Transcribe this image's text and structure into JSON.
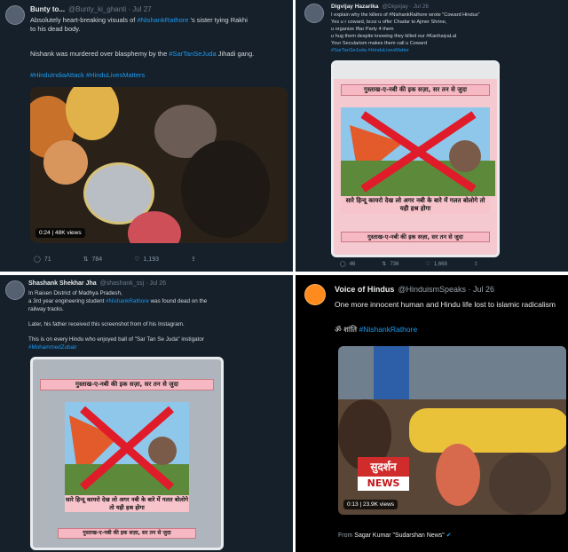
{
  "p1": {
    "name": "Bunty to...",
    "handle": "@Bunty_ki_ghanti · Jul 27",
    "line1_a": "Absolutely heart-breaking visuals of ",
    "line1_tag": "#NishankRathore",
    "line1_b": " 's sister tying Rakhi",
    "line2": "to his dead body.",
    "line3_a": "Nishank was murdered over blasphemy by the ",
    "line3_tag": "#SarTanSeJuda",
    "line3_b": " Jihadi gang.",
    "tags": "#HinduIndiaAttack #HinduLivesMatters",
    "video_time": "0:24",
    "video_views": "48K views",
    "replies": "71",
    "retweets": "784",
    "likes": "1,193"
  },
  "p2": {
    "name": "Digvijay Hazarika",
    "handle": "@Digvijay · Jul 26",
    "l1": "I explain why the killers of #NishankRathore wrote \"Coward Hindus\"",
    "l2": "Yes u r coward, bcoz u offer Chadar to Ajmer Shrine,",
    "l3": "u organize Iftar Party 4 them",
    "l4": "u hug them despite knowing they killed our #KanhaiyaLal",
    "l5": "Your Secularism makes them call u Coward",
    "l6": "#SarTanSeJuda #HinduLivesMatter",
    "poster_head": "गुस्ताख-ए-नबी की इक सज़ा, सर तन से जुदा",
    "poster_mid": "सारे हिन्दू कायरो देख लो अगर नबी के बारे में गलत बोलोगे तो यही हश्र होगा",
    "poster_foot": "गुस्ताख-ए-नबी की इक सज़ा, सर तन से जुदा",
    "replies": "46",
    "retweets": "736",
    "likes": "1,668"
  },
  "p3": {
    "name": "Shashank Shekhar Jha",
    "handle": "@shashank_ssj · Jul 26",
    "l1": "In Raisen District of Madhya Pradesh,",
    "l2a": "a 3rd year engineering student ",
    "l2tag": "#NishankRathore",
    "l2b": " was found dead on the",
    "l3": "railway tracks.",
    "l4": "Later, his father received this screenshot from of his Instagram.",
    "l5": "This is on every Hindu who enjoyed ball of \"Sar Tan Se Juda\" instigator",
    "l6": "#MohammedZubair",
    "poster_head": "गुस्ताख-ए-नबी की इक सज़ा, सर तन से जुदा",
    "poster_mid": "सारे हिन्दू कायरो देख लो अगर नबी के बारे में गलत बोलोगे तो यही हश्र होगा",
    "poster_foot": "गुस्ताख-ए-नबी की इक सज़ा, सर तन से जुदा"
  },
  "p4": {
    "name": "Voice of Hindus",
    "handle": "@HinduismSpeaks · Jul 26",
    "l1": "One more innocent human and Hindu life lost to islamic radicalism",
    "l2a": "ॐ शांति ",
    "l2tag": "#NishankRathore",
    "logo_top": "सुदर्शन",
    "logo_bot": "NEWS",
    "video_time": "0:13",
    "video_views": "23.9K views",
    "from_label": "From ",
    "from_name": "Sagar Kumar \"Sudarshan News\""
  },
  "colors": {
    "link": "#1d9bf0",
    "panel": "#15202b",
    "cross": "#e01b2a"
  }
}
